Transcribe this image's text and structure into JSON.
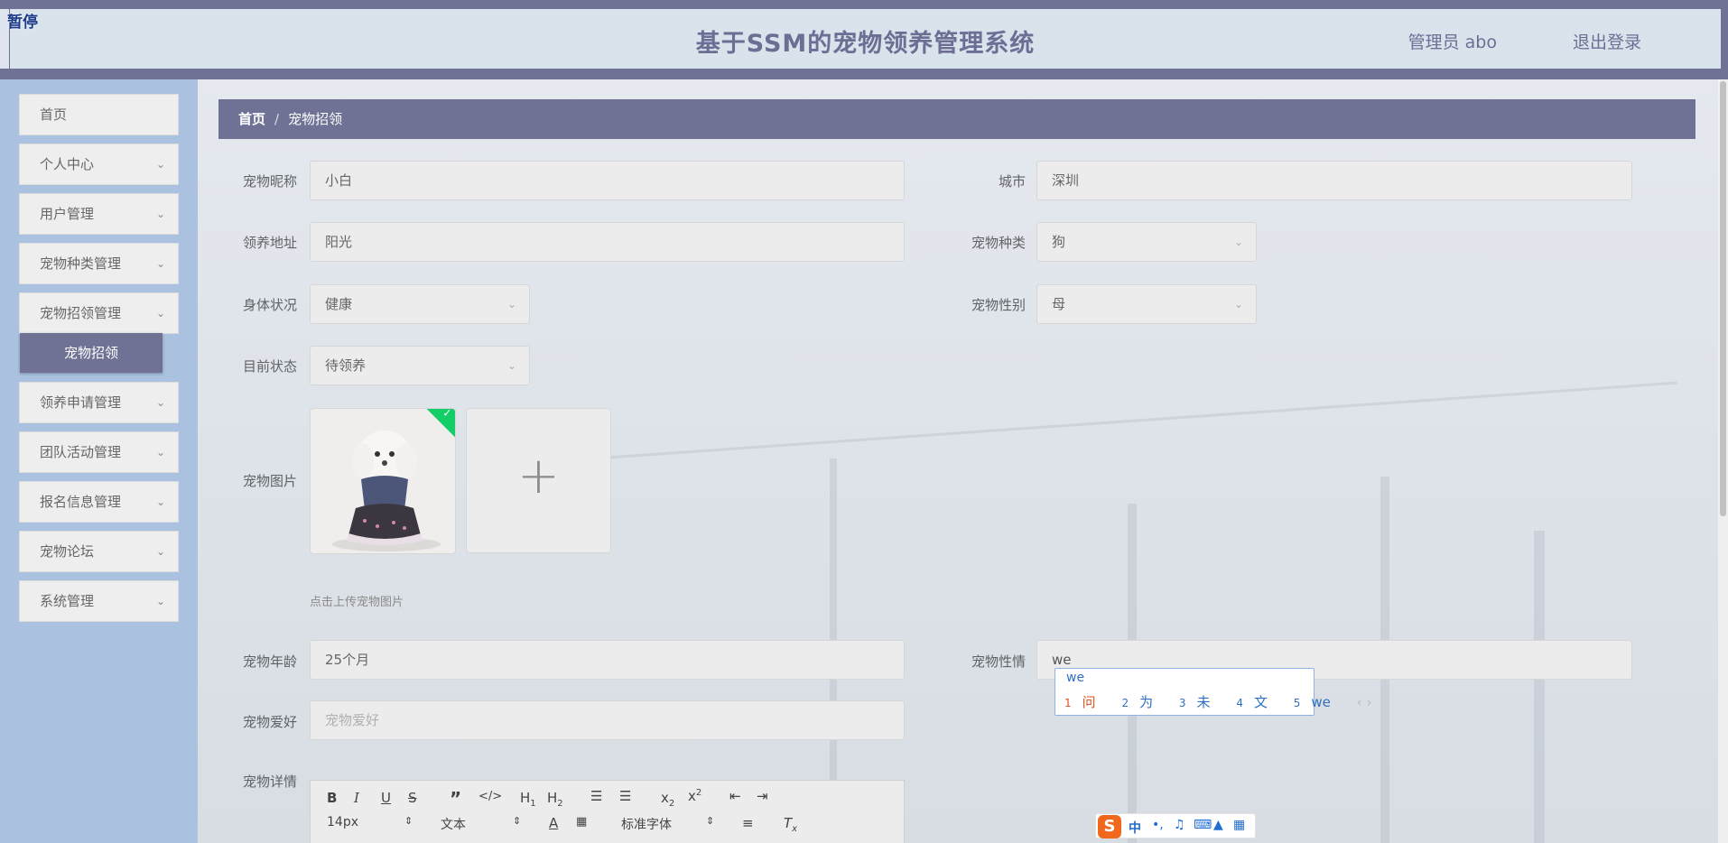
{
  "header": {
    "overlay_tag": "暂停",
    "title": "基于SSM的宠物领养管理系统",
    "user": "管理员 abo",
    "logout": "退出登录"
  },
  "sidebar": {
    "items": [
      {
        "label": "首页",
        "expandable": false
      },
      {
        "label": "个人中心",
        "expandable": true
      },
      {
        "label": "用户管理",
        "expandable": true
      },
      {
        "label": "宠物种类管理",
        "expandable": true
      },
      {
        "label": "宠物招领管理",
        "expandable": true
      },
      {
        "label": "领养申请管理",
        "expandable": true
      },
      {
        "label": "团队活动管理",
        "expandable": true
      },
      {
        "label": "报名信息管理",
        "expandable": true
      },
      {
        "label": "宠物论坛",
        "expandable": true
      },
      {
        "label": "系统管理",
        "expandable": true
      }
    ],
    "active_sub": "宠物招领"
  },
  "breadcrumb": {
    "home": "首页",
    "sep": "/",
    "current": "宠物招领"
  },
  "form": {
    "nickname": {
      "label": "宠物昵称",
      "value": "小白"
    },
    "city": {
      "label": "城市",
      "value": "深圳"
    },
    "address": {
      "label": "领养地址",
      "value": "阳光"
    },
    "species": {
      "label": "宠物种类",
      "value": "狗"
    },
    "health": {
      "label": "身体状况",
      "value": "健康"
    },
    "gender": {
      "label": "宠物性别",
      "value": "母"
    },
    "status": {
      "label": "目前状态",
      "value": "待领养"
    },
    "image": {
      "label": "宠物图片",
      "tip": "点击上传宠物图片",
      "add": "+"
    },
    "age": {
      "label": "宠物年龄",
      "value": "25个月"
    },
    "temper": {
      "label": "宠物性情",
      "value": "we"
    },
    "hobby": {
      "label": "宠物爱好",
      "placeholder": "宠物爱好"
    },
    "detail": {
      "label": "宠物详情"
    }
  },
  "editor": {
    "font_size": "14px",
    "block": "文本",
    "font": "标准字体"
  },
  "ime": {
    "input": "we",
    "candidates": [
      {
        "num": "1",
        "text": "问"
      },
      {
        "num": "2",
        "text": "为"
      },
      {
        "num": "3",
        "text": "未"
      },
      {
        "num": "4",
        "text": "文"
      },
      {
        "num": "5",
        "text": "we"
      }
    ],
    "nav": "‹ ›",
    "bar_mode": "中",
    "bar_punct": "•,"
  }
}
